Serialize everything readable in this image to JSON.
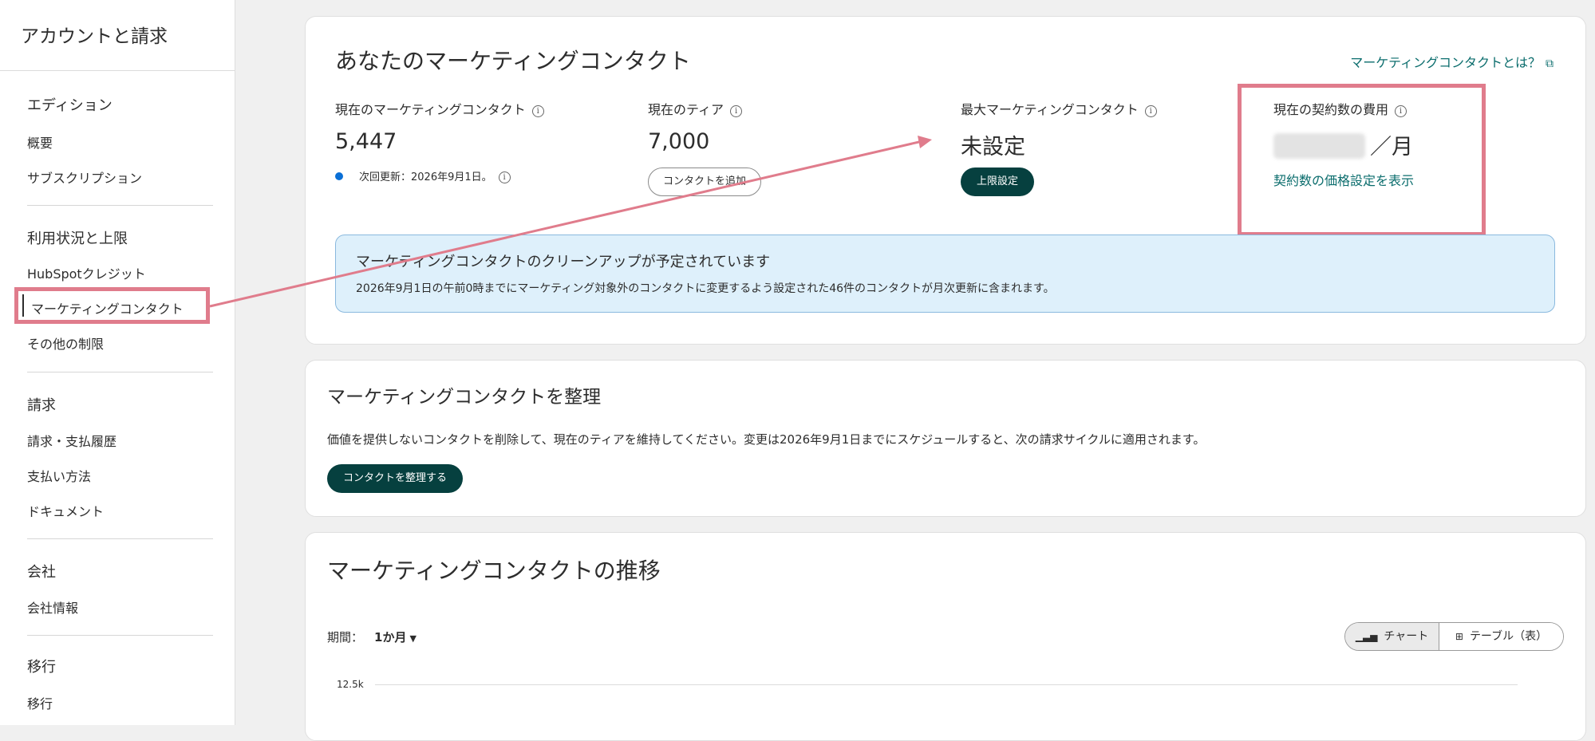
{
  "sidebar": {
    "title": "アカウントと請求",
    "sections": [
      {
        "heading": "エディション",
        "items": [
          "概要",
          "サブスクリプション"
        ]
      },
      {
        "heading": "利用状況と上限",
        "items": [
          "HubSpotクレジット",
          "マーケティングコンタクト",
          "その他の制限"
        ]
      },
      {
        "heading": "請求",
        "items": [
          "請求・支払履歴",
          "支払い方法",
          "ドキュメント"
        ]
      },
      {
        "heading": "会社",
        "items": [
          "会社情報"
        ]
      },
      {
        "heading": "移行",
        "items": [
          "移行"
        ]
      }
    ],
    "active_item": "マーケティングコンタクト"
  },
  "marketing_contacts": {
    "title": "あなたのマーケティングコンタクト",
    "help_link": "マーケティングコンタクトとは？",
    "current_label": "現在のマーケティングコンタクト",
    "current_value": "5,447",
    "renewal_text": "次回更新：2026年9月1日。",
    "tier_label": "現在のティア",
    "tier_value": "7,000",
    "add_contacts_button": "コンタクトを追加",
    "max_label": "最大マーケティングコンタクト",
    "max_value": "未設定",
    "set_limit_button": "上限設定",
    "cost_label": "現在の契約数の費用",
    "cost_suffix": "／月",
    "pricing_link": "契約数の価格設定を表示",
    "banner_title": "マーケティングコンタクトのクリーンアップが予定されています",
    "banner_body": "2026年9月1日の午前0時までにマーケティング対象外のコンタクトに変更するよう設定された46件のコンタクトが月次更新に含まれます。"
  },
  "organize": {
    "title": "マーケティングコンタクトを整理",
    "body": "価値を提供しないコンタクトを削除して、現在のティアを維持してください。変更は2026年9月1日までにスケジュールすると、次の請求サイクルに適用されます。",
    "button": "コンタクトを整理する"
  },
  "trend": {
    "title": "マーケティングコンタクトの推移",
    "period_label": "期間：",
    "period_value": "1か月",
    "view_chart": "チャート",
    "view_table": "テーブル（表）",
    "y_tick": "12.5k"
  },
  "colors": {
    "highlight": "#e07c8c",
    "primary_button": "#06403f",
    "link": "#0b6d6d",
    "banner_bg": "#def0fb"
  }
}
